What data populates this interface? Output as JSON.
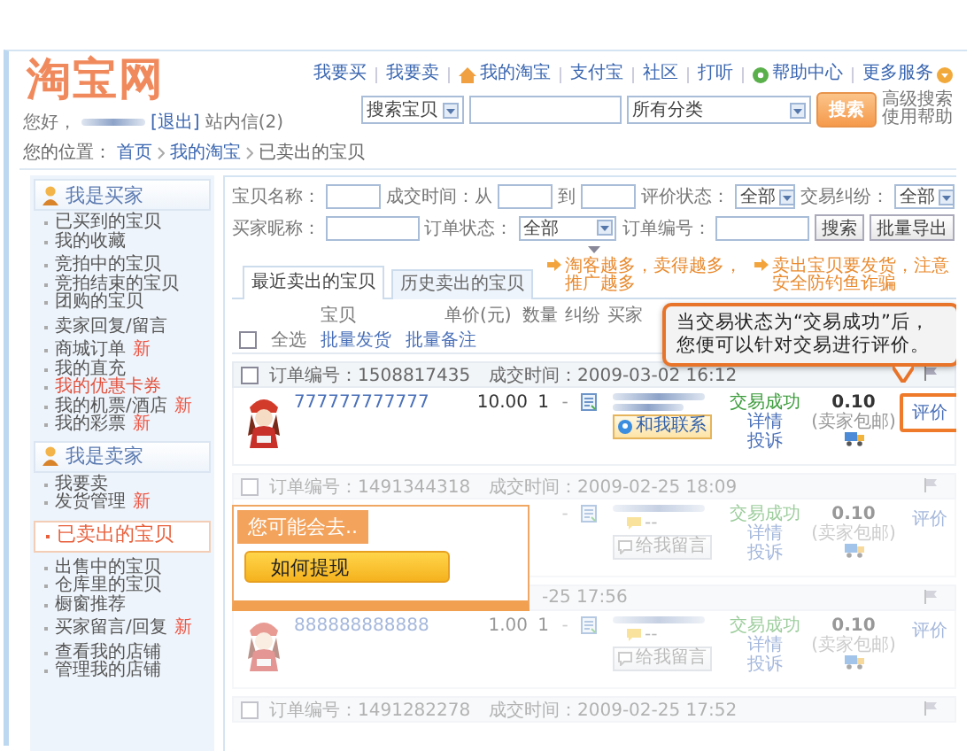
{
  "logo": "淘宝网",
  "top_nav": [
    {
      "label": "我要买",
      "kind": "plain"
    },
    {
      "label": "我要卖",
      "kind": "plain"
    },
    {
      "label": "我的淘宝",
      "kind": "home"
    },
    {
      "label": "支付宝",
      "kind": "plain"
    },
    {
      "label": "社区",
      "kind": "plain"
    },
    {
      "label": "打听",
      "kind": "plain"
    },
    {
      "label": "帮助中心",
      "kind": "help"
    },
    {
      "label": "更多服务",
      "kind": "more"
    }
  ],
  "search": {
    "scope": "搜索宝贝",
    "category": "所有分类",
    "button": "搜索",
    "links": [
      "高级搜索",
      "使用帮助"
    ]
  },
  "greeting": {
    "hello": "您好，",
    "logout": "[退出]",
    "messages": "站内信(2)"
  },
  "breadcrumb": {
    "label": "您的位置：",
    "items": [
      "首页",
      "我的淘宝",
      "已卖出的宝贝"
    ]
  },
  "sidebar": [
    {
      "title": "我是买家",
      "groups": [
        [
          {
            "label": "已买到的宝贝",
            "selected": false,
            "emphasis": false
          },
          {
            "label": "我的收藏",
            "selected": false,
            "emphasis": false
          }
        ],
        [
          {
            "label": "竞拍中的宝贝",
            "selected": false,
            "emphasis": false
          },
          {
            "label": "竞拍结束的宝贝",
            "selected": false,
            "emphasis": false
          },
          {
            "label": "团购的宝贝",
            "selected": false,
            "emphasis": false
          }
        ],
        [
          {
            "label": "卖家回复/留言",
            "selected": false,
            "emphasis": false
          }
        ],
        [
          {
            "label": "商城订单",
            "badge": "新",
            "selected": false,
            "emphasis": false
          },
          {
            "label": "我的直充",
            "selected": false,
            "emphasis": false
          },
          {
            "label": "我的优惠卡券",
            "selected": false,
            "emphasis": true
          },
          {
            "label": "我的机票/酒店",
            "badge": "新",
            "selected": false,
            "emphasis": false
          },
          {
            "label": "我的彩票",
            "badge": "新",
            "selected": false,
            "emphasis": false
          }
        ]
      ]
    },
    {
      "title": "我是卖家",
      "groups": [
        [
          {
            "label": "我要卖",
            "selected": false,
            "emphasis": false
          },
          {
            "label": "发货管理",
            "badge": "新",
            "selected": false,
            "emphasis": false
          }
        ],
        [
          {
            "label": "已卖出的宝贝",
            "selected": true,
            "emphasis": false
          }
        ],
        [
          {
            "label": "出售中的宝贝",
            "selected": false,
            "emphasis": false
          },
          {
            "label": "仓库里的宝贝",
            "selected": false,
            "emphasis": false
          },
          {
            "label": "橱窗推荐",
            "selected": false,
            "emphasis": false
          }
        ],
        [
          {
            "label": "买家留言/回复",
            "badge": "新",
            "selected": false,
            "emphasis": false
          }
        ],
        [
          {
            "label": "查看我的店铺",
            "selected": false,
            "emphasis": false
          },
          {
            "label": "管理我的店铺",
            "selected": false,
            "emphasis": false
          }
        ]
      ]
    }
  ],
  "filters": {
    "row_1": [
      {
        "kind": "label",
        "text": "宝贝名称："
      },
      {
        "kind": "input"
      },
      {
        "kind": "label",
        "text": "成交时间：从"
      },
      {
        "kind": "input"
      },
      {
        "kind": "label",
        "text": "到"
      },
      {
        "kind": "input"
      },
      {
        "kind": "label",
        "text": "评价状态："
      },
      {
        "kind": "select",
        "value": "全部"
      },
      {
        "kind": "label",
        "text": "交易纠纷："
      },
      {
        "kind": "select",
        "value": "全部"
      }
    ],
    "row_2": [
      {
        "kind": "label",
        "text": "买家昵称："
      },
      {
        "kind": "input"
      },
      {
        "kind": "label",
        "text": "订单状态："
      },
      {
        "kind": "select",
        "value": "全部"
      },
      {
        "kind": "label",
        "text": "订单编号："
      },
      {
        "kind": "input"
      },
      {
        "kind": "button",
        "text": "搜索"
      },
      {
        "kind": "button",
        "text": "批量导出"
      }
    ]
  },
  "tabs": [
    {
      "label": "最近卖出的宝贝",
      "selected": true
    },
    {
      "label": "历史卖出的宝贝",
      "selected": false
    }
  ],
  "tips": [
    "淘客越多，卖得越多，推广越多",
    "卖出宝贝要发货，注意安全防钓鱼诈骗"
  ],
  "columns": [
    "宝贝",
    "单价(元)",
    "数量",
    "纠纷",
    "买家"
  ],
  "batch": {
    "checked": false,
    "select_all": "全选",
    "actions": [
      "批量发货",
      "批量备注"
    ]
  },
  "orders": [
    {
      "checked": false,
      "order_no": "订单编号：1508817435",
      "time": "成交时间：2009-03-02 16:12",
      "dimmed": false,
      "title": "777777777777",
      "price": "10.00",
      "qty": "1",
      "dispute": "-",
      "contact": {
        "kind": "chat",
        "text": "和我联系"
      },
      "status": [
        "交易成功",
        "详情",
        "投诉"
      ],
      "amount": "0.10",
      "shipping": "(卖家包邮)",
      "rate": "评价",
      "highlighted": true
    },
    {
      "checked": false,
      "order_no": "订单编号：1491344318",
      "time": "成交时间：2009-02-25 18:09",
      "dimmed": true,
      "dispute": "-",
      "note": "--",
      "contact": {
        "kind": "message",
        "text": "给我留言"
      },
      "status": [
        "交易成功",
        "详情",
        "投诉"
      ],
      "amount": "0.10",
      "shipping": "(卖家包邮)",
      "rate": "评价",
      "highlighted": false
    },
    {
      "time": "-25 17:56",
      "dimmed": true,
      "title": "888888888888",
      "price": "1.00",
      "qty": "1",
      "dispute": "-",
      "note": "--",
      "contact": {
        "kind": "message",
        "text": "给我留言"
      },
      "status": [
        "交易成功",
        "详情",
        "投诉"
      ],
      "amount": "0.10",
      "shipping": "(卖家包邮)",
      "rate": "评价",
      "highlighted": false
    },
    {
      "checked": false,
      "order_no": "订单编号：1491282278",
      "time": "成交时间：2009-02-25 17:52",
      "dimmed": true
    }
  ],
  "callout": "当交易状态为“交易成功”后，您便可以针对交易进行评价。",
  "popup": {
    "title": "您可能会去..",
    "button": "如何提现"
  }
}
